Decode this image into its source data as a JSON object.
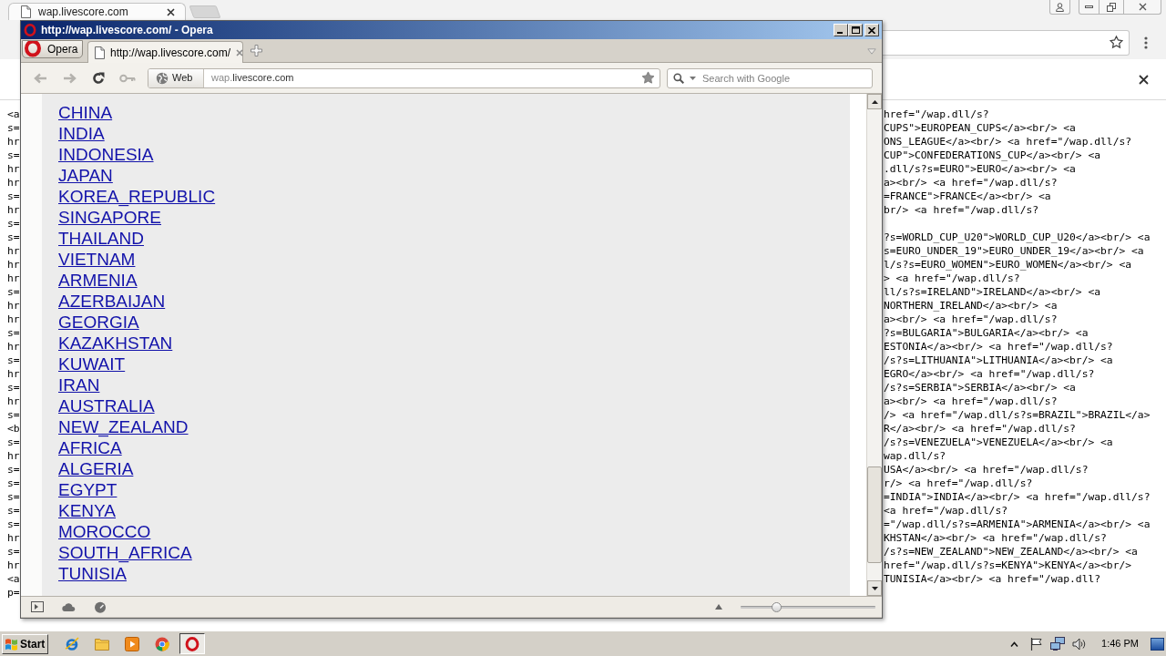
{
  "chrome_window": {
    "tabs": [
      {
        "label": "wap.livescore.com",
        "selected": true
      }
    ]
  },
  "source_view": {
    "lines": [
      {
        "left": "<a",
        "right": "href=\"/wap.dll/s?"
      },
      {
        "left": "s=",
        "right": "CUPS\">EUROPEAN_CUPS</a><br/> <a"
      },
      {
        "left": "hr",
        "right": "ONS_LEAGUE</a><br/> <a href=\"/wap.dll/s?"
      },
      {
        "left": "s=",
        "right": "CUP\">CONFEDERATIONS_CUP</a><br/> <a"
      },
      {
        "left": "hr",
        "right": ".dll/s?s=EURO\">EURO</a><br/> <a"
      },
      {
        "left": "hr",
        "right": "a><br/> <a href=\"/wap.dll/s?"
      },
      {
        "left": "s=",
        "right": "=FRANCE\">FRANCE</a><br/> <a"
      },
      {
        "left": "hr",
        "right": "br/> <a href=\"/wap.dll/s?"
      },
      {
        "left": "s="
      },
      {
        "left": "s=",
        "right": "?s=WORLD_CUP_U20\">WORLD_CUP_U20</a><br/> <a"
      },
      {
        "left": "hr",
        "right": "s=EURO_UNDER_19\">EURO_UNDER_19</a><br/> <a"
      },
      {
        "left": "hr",
        "right": "l/s?s=EURO_WOMEN\">EURO_WOMEN</a><br/> <a"
      },
      {
        "left": "hr",
        "right": "> <a href=\"/wap.dll/s?"
      },
      {
        "left": "s=",
        "right": "ll/s?s=IRELAND\">IRELAND</a><br/> <a"
      },
      {
        "left": "hr",
        "right": "NORTHERN_IRELAND</a><br/> <a"
      },
      {
        "left": "hr",
        "right": "a><br/> <a href=\"/wap.dll/s?"
      },
      {
        "left": "s=",
        "right": "?s=BULGARIA\">BULGARIA</a><br/> <a"
      },
      {
        "left": "hr",
        "right": "ESTONIA</a><br/> <a href=\"/wap.dll/s?"
      },
      {
        "left": "s=",
        "right": "/s?s=LITHUANIA\">LITHUANIA</a><br/> <a"
      },
      {
        "left": "hr",
        "right": "EGRO</a><br/> <a href=\"/wap.dll/s?"
      },
      {
        "left": "s=",
        "right": "/s?s=SERBIA\">SERBIA</a><br/> <a"
      },
      {
        "left": "hr",
        "right": "a><br/> <a href=\"/wap.dll/s?"
      },
      {
        "left": "s=",
        "right": "/> <a href=\"/wap.dll/s?s=BRAZIL\">BRAZIL</a>"
      },
      {
        "left": "<b",
        "right": "R</a><br/> <a href=\"/wap.dll/s?"
      },
      {
        "left": "s=",
        "right": "/s?s=VENEZUELA\">VENEZUELA</a><br/> <a"
      },
      {
        "left": "hr",
        "right": "wap.dll/s?"
      },
      {
        "left": "s=",
        "right": "USA</a><br/> <a href=\"/wap.dll/s?"
      },
      {
        "left": "s=",
        "right": "r/> <a href=\"/wap.dll/s?"
      },
      {
        "left": "s=",
        "right": "=INDIA\">INDIA</a><br/> <a href=\"/wap.dll/s?"
      },
      {
        "left": "s=",
        "right": "<a href=\"/wap.dll/s?"
      },
      {
        "left": "s=",
        "right": "=\"/wap.dll/s?s=ARMENIA\">ARMENIA</a><br/> <a"
      },
      {
        "left": "hr",
        "right": "KHSTAN</a><br/> <a href=\"/wap.dll/s?"
      },
      {
        "left": "s=",
        "right": "/s?s=NEW_ZEALAND\">NEW_ZEALAND</a><br/> <a"
      },
      {
        "left": "hr",
        "right": "href=\"/wap.dll/s?s=KENYA\">KENYA</a><br/>"
      },
      {
        "left": "<a",
        "right": "TUNISIA</a><br/> <a href=\"/wap.dll?"
      },
      {
        "left": "p="
      }
    ]
  },
  "opera_window": {
    "title": "http://wap.livescore.com/ - Opera",
    "menu_button": "Opera",
    "tabs": [
      {
        "label": "http://wap.livescore.com/",
        "selected": true
      }
    ],
    "toolbar_buttons": [
      {
        "kind": "back",
        "disabled": true
      },
      {
        "kind": "forward",
        "disabled": true
      },
      {
        "kind": "reload",
        "disabled": false
      },
      {
        "kind": "key",
        "disabled": true
      }
    ],
    "address_bar": {
      "badge": "Web",
      "url_prefix": "wap.",
      "url_domain": "livescore.com"
    },
    "search": {
      "placeholder": "Search with Google"
    },
    "page": {
      "links": [
        "CHINA",
        "INDIA",
        "INDONESIA",
        "JAPAN",
        "KOREA_REPUBLIC",
        "SINGAPORE",
        "THAILAND",
        "VIETNAM",
        "ARMENIA",
        "AZERBAIJAN",
        "GEORGIA",
        "KAZAKHSTAN",
        "KUWAIT",
        "IRAN",
        "AUSTRALIA",
        "NEW_ZEALAND",
        "AFRICA",
        "ALGERIA",
        "EGYPT",
        "KENYA",
        "MOROCCO",
        "SOUTH_AFRICA",
        "TUNISIA"
      ]
    },
    "zoom": {
      "level": 0.25
    }
  },
  "taskbar": {
    "start_button": "Start",
    "apps": [
      {
        "kind": "browser",
        "selected": false
      },
      {
        "kind": "folder",
        "selected": false
      },
      {
        "kind": "player",
        "selected": false
      },
      {
        "kind": "chrome",
        "selected": false
      },
      {
        "kind": "opera",
        "selected": true
      }
    ],
    "clock": "1:46 PM"
  }
}
